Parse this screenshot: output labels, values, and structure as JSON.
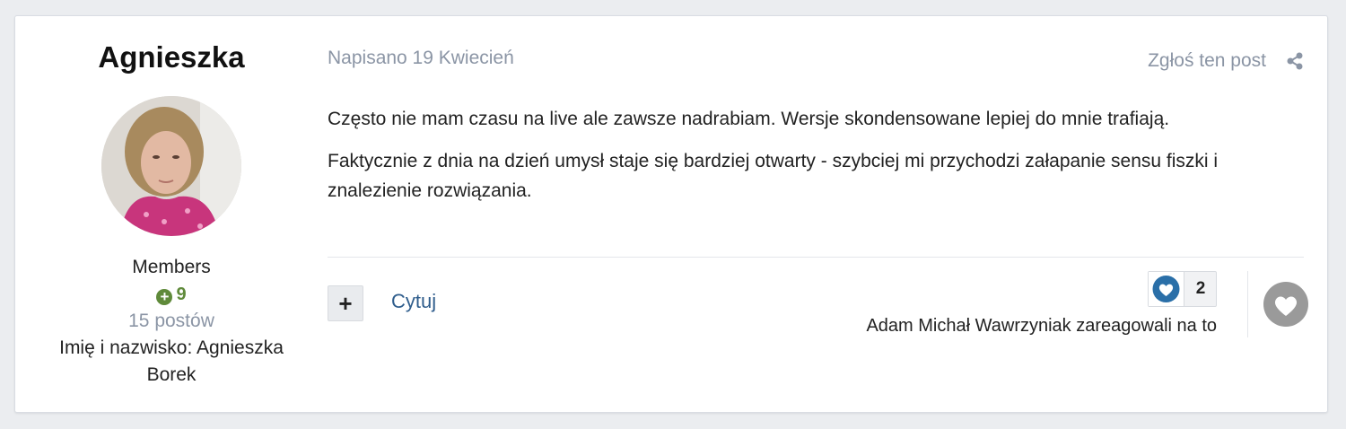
{
  "author": {
    "name": "Agnieszka",
    "group": "Members",
    "reputation": "9",
    "posts": "15 postów",
    "full_name": "Imię i nazwisko: Agnieszka Borek"
  },
  "post": {
    "date": "Napisano 19 Kwiecień",
    "report_label": "Zgłoś ten post",
    "paragraphs": [
      "Często nie mam czasu na live ale zawsze nadrabiam. Wersje skondensowane lepiej do mnie trafiają.",
      "Faktycznie z dnia na dzień umysł staje się bardziej otwarty - szybciej mi przychodzi załapanie sensu fiszki i znalezienie rozwiązania."
    ]
  },
  "actions": {
    "plus_label": "+",
    "quote_label": "Cytuj"
  },
  "reactions": {
    "count": "2",
    "reacted_text": "Adam Michał Wawrzyniak zareagowali na to",
    "icon": "like-heart-icon"
  },
  "colors": {
    "link": "#2f5d8c",
    "muted": "#8b95a5",
    "reputation": "#5f8a3a",
    "like_blue": "#2a6fa8"
  }
}
